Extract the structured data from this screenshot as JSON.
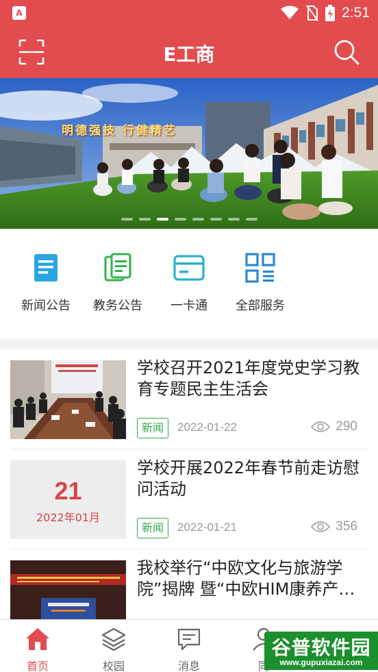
{
  "status_bar": {
    "time": "2:51",
    "app_badge": "A",
    "icons": [
      "wifi-icon",
      "no-sim-icon",
      "battery-charging-icon"
    ]
  },
  "app_bar": {
    "title": "E工商",
    "left_icon": "scan-icon",
    "right_icon": "search-icon",
    "background": "#e24c4f"
  },
  "banner": {
    "slogan": "明德强技 行健精艺",
    "slide_count": 8,
    "active_slide": 3
  },
  "quick_nav": [
    {
      "label": "新闻公告",
      "icon": "news-doc-icon",
      "color": "#2aa5de"
    },
    {
      "label": "教务公告",
      "icon": "academic-docs-icon",
      "color": "#2fb34b"
    },
    {
      "label": "一卡通",
      "icon": "card-icon",
      "color": "#29b3c9"
    },
    {
      "label": "全部服务",
      "icon": "grid-services-icon",
      "color": "#2a86d1"
    }
  ],
  "news": [
    {
      "title": "学校召开2021年度党史学习教育专题民主生活会",
      "tag": "新闻",
      "date": "2022-01-22",
      "views": "290",
      "thumb_type": "photo"
    },
    {
      "title": "学校开展2022年春节前走访慰问活动",
      "tag": "新闻",
      "date": "2022-01-21",
      "views": "356",
      "thumb_type": "date",
      "thumb_day": "21",
      "thumb_month": "2022年01月"
    },
    {
      "title": "我校举行“中欧文化与旅游学院”揭牌 暨“中欧HIM康养产…",
      "thumb_type": "photo"
    }
  ],
  "tab_bar": [
    {
      "label": "首页",
      "icon": "home-icon",
      "active": true
    },
    {
      "label": "校园",
      "icon": "layers-icon",
      "active": false
    },
    {
      "label": "消息",
      "icon": "message-icon",
      "active": false
    },
    {
      "label": "同",
      "icon": "contacts-icon",
      "active": false
    }
  ],
  "watermark": {
    "title": "谷普软件园",
    "url": "www.gupuxiazai.com"
  },
  "colors": {
    "accent": "#e24c4f",
    "tag_green": "#2fa84f",
    "meta_gray": "#999999"
  }
}
